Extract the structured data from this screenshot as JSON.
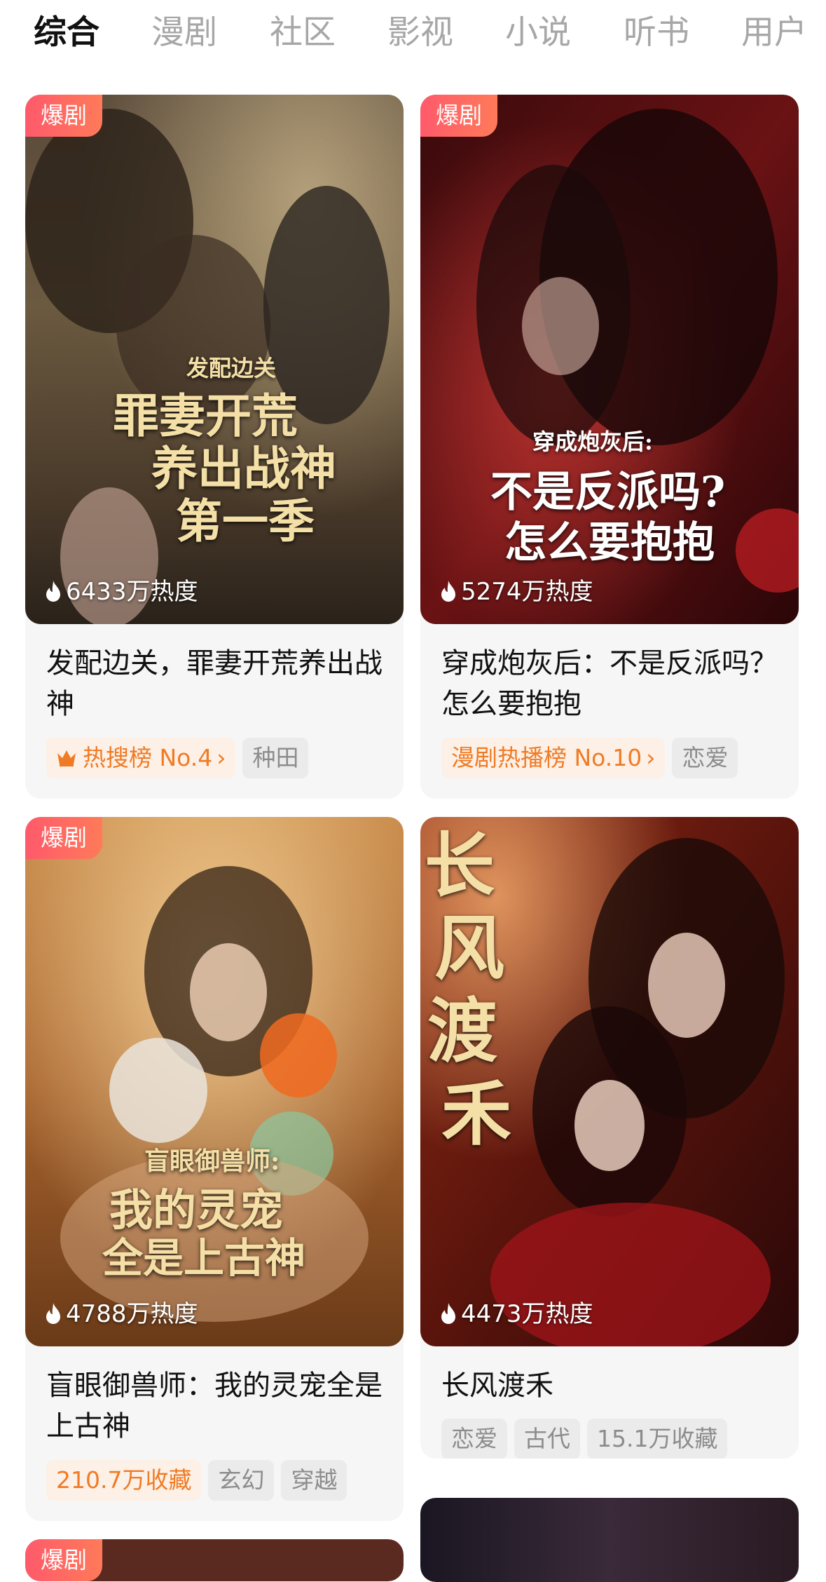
{
  "tabs": [
    {
      "label": "综合",
      "active": true
    },
    {
      "label": "漫剧"
    },
    {
      "label": "社区"
    },
    {
      "label": "影视"
    },
    {
      "label": "小说"
    },
    {
      "label": "听书"
    },
    {
      "label": "用户"
    }
  ],
  "cards": [
    {
      "badge": "爆剧",
      "heat": "6433万热度",
      "poster_lines": [
        "发配边关",
        "罪妻开荒",
        "养出战神",
        "第一季"
      ],
      "title": "发配边关，罪妻开荒养出战神",
      "rank_tag": "热搜榜 No.4",
      "tags": [
        "种田"
      ]
    },
    {
      "badge": "爆剧",
      "heat": "5274万热度",
      "poster_lines": [
        "穿成炮灰后:",
        "不是反派吗?",
        "怎么要抱抱"
      ],
      "title": "穿成炮灰后：不是反派吗？怎么要抱抱",
      "rank_tag": "漫剧热播榜 No.10",
      "tags": [
        "恋爱"
      ]
    },
    {
      "badge": "爆剧",
      "heat": "4788万热度",
      "poster_lines": [
        "盲眼御兽师:",
        "我的灵宠",
        "全是上古神"
      ],
      "title": "盲眼御兽师：我的灵宠全是上古神",
      "rank_tag": "210.7万收藏",
      "tags": [
        "玄幻",
        "穿越"
      ]
    },
    {
      "heat": "4473万热度",
      "poster_lines": [
        "长",
        "风",
        "渡",
        "禾"
      ],
      "title": "长风渡禾",
      "tags": [
        "恋爱",
        "古代",
        "15.1万收藏"
      ]
    },
    {
      "badge": "爆剧"
    }
  ],
  "colors": {
    "accent": "#f07b25",
    "badge": "#ff5a6b"
  }
}
